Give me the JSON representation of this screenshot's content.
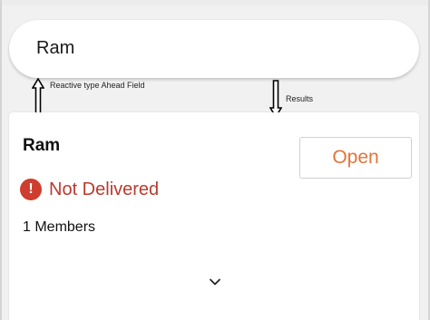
{
  "search": {
    "value": "Ram"
  },
  "annotations": {
    "field_note": "Reactive type Ahead Field",
    "results_note": "Results"
  },
  "result": {
    "title": "Ram",
    "open_label": "Open",
    "status_icon": "alert-circle-icon",
    "status_text": "Not Delivered",
    "members": "1 Members",
    "expand_icon": "chevron-down-icon"
  },
  "colors": {
    "accent": "#e0753a",
    "error": "#cf3d2e",
    "error_text": "#b93a2f"
  }
}
